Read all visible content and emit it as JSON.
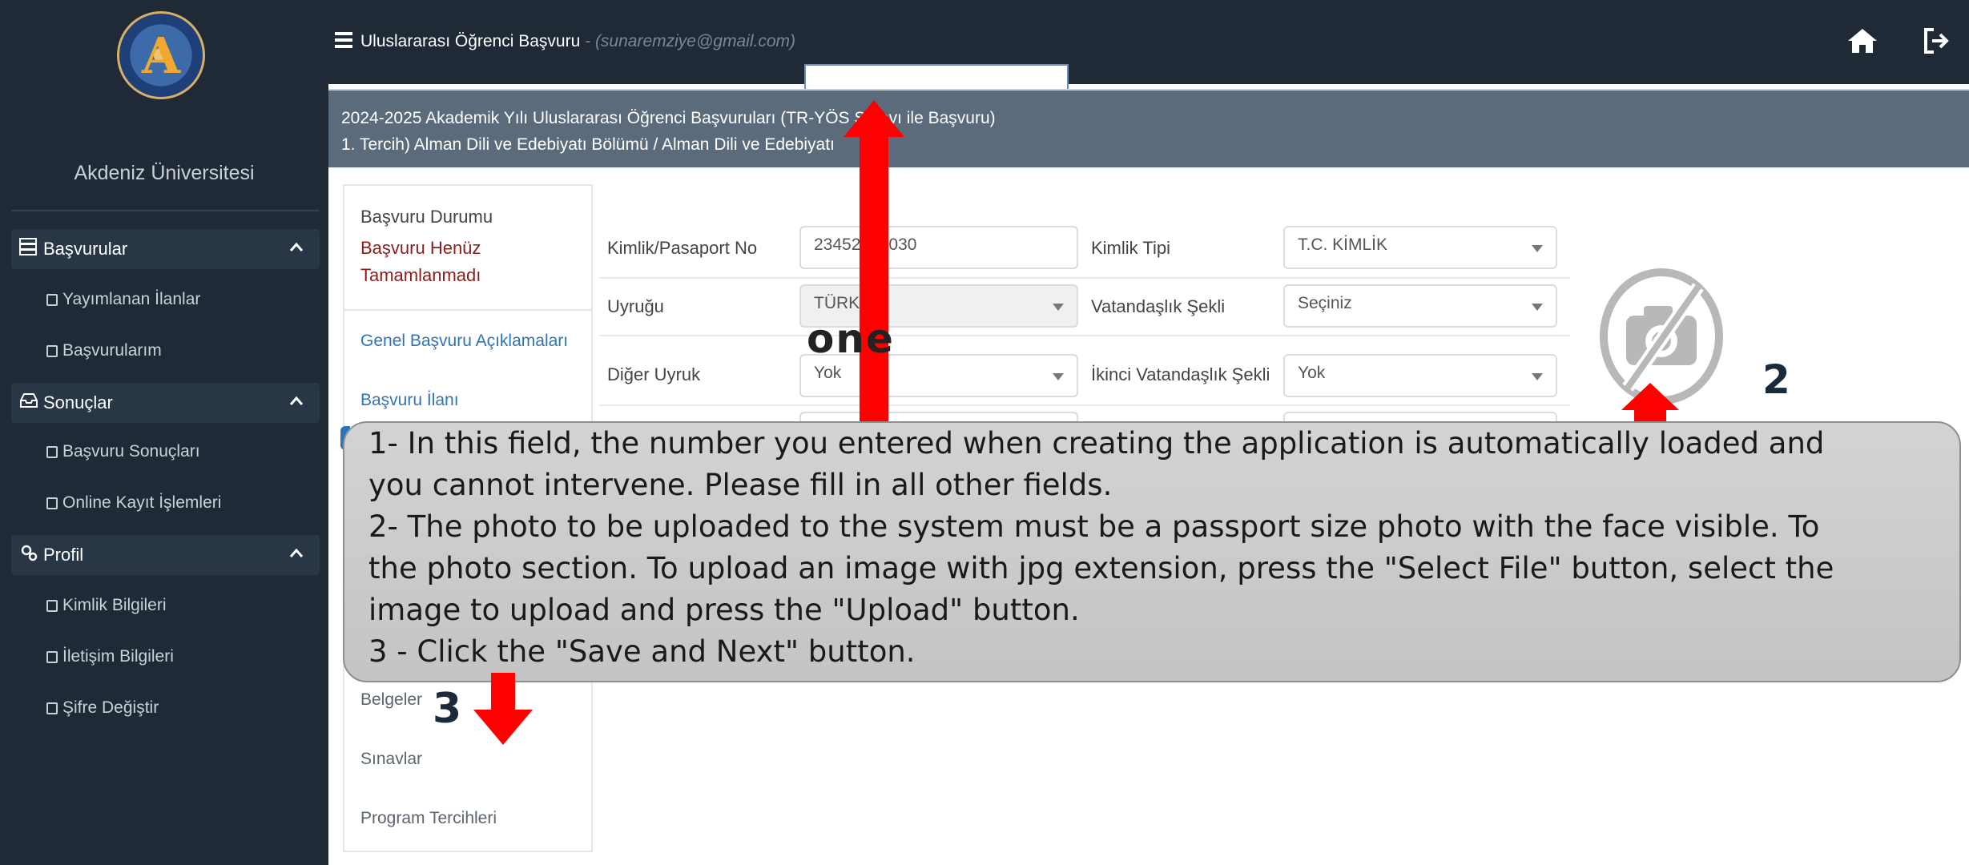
{
  "sidebar": {
    "university_name": "Akdeniz Üniversitesi",
    "groups": [
      {
        "label": "Başvurular",
        "icon": "server-icon",
        "items": [
          "Yayımlanan İlanlar",
          "Başvurularım"
        ]
      },
      {
        "label": "Sonuçlar",
        "icon": "inbox-icon",
        "items": [
          "Başvuru Sonuçları",
          "Online Kayıt İşlemleri"
        ]
      },
      {
        "label": "Profil",
        "icon": "cogs-icon",
        "items": [
          "Kimlik Bilgileri",
          "İletişim Bilgileri",
          "Şifre Değiştir"
        ]
      }
    ]
  },
  "topbar": {
    "title": "Uluslararası Öğrenci Başvuru",
    "email": " - (sunaremziye@gmail.com)"
  },
  "header_band": {
    "line1": "2024-2025 Akademik Yılı Uluslararası Öğrenci Başvuruları (TR-YÖS Sınavı ile Başvuru)",
    "line2": "1. Tercih) Alman Dili ve Edebiyatı Bölümü / Alman Dili ve Edebiyatı"
  },
  "nav": {
    "status_label": "Başvuru Durumu",
    "status_value": "Başvuru Henüz Tamamlanmadı",
    "links": [
      "Genel Başvuru Açıklamaları",
      "Başvuru İlanı"
    ],
    "items": [
      "Belgeler",
      "Sınavlar",
      "Program Tercihleri"
    ]
  },
  "form": {
    "id_label": "Kimlik/Pasaport No",
    "id_value": "23452000030",
    "id_type_label": "Kimlik Tipi",
    "id_type_value": "T.C. KİMLİK",
    "nationality_label": "Uyruğu",
    "nationality_value": "TÜRKİYE",
    "citizenship_label": "Vatandaşlık Şekli",
    "citizenship_value": "Seçiniz",
    "other_nat_label": "Diğer Uyruk",
    "other_nat_value": "Yok",
    "second_cit_label": "İkinci Vatandaşlık Şekli",
    "second_cit_value": "Yok"
  },
  "annotations": {
    "one": "one",
    "two": "2",
    "three": "3",
    "callout_lines": [
      "1- In this field, the number you entered when creating the application is automatically loaded and",
      "you cannot intervene. Please fill in all other fields.",
      "2- The photo to be uploaded to the system must be a passport size photo with the face visible. To",
      "the photo section. To upload an image with jpg extension, press the \"Select File\" button, select the",
      "image to upload and press the \"Upload\" button.",
      "3 - Click the \"Save and Next\" button."
    ]
  },
  "colors": {
    "sidebar_bg": "#1f2a36",
    "band_bg": "#5b6b7b",
    "link_blue": "#2f74b8",
    "status_red": "#8b1d1d",
    "annotation_red": "#ff0000"
  }
}
